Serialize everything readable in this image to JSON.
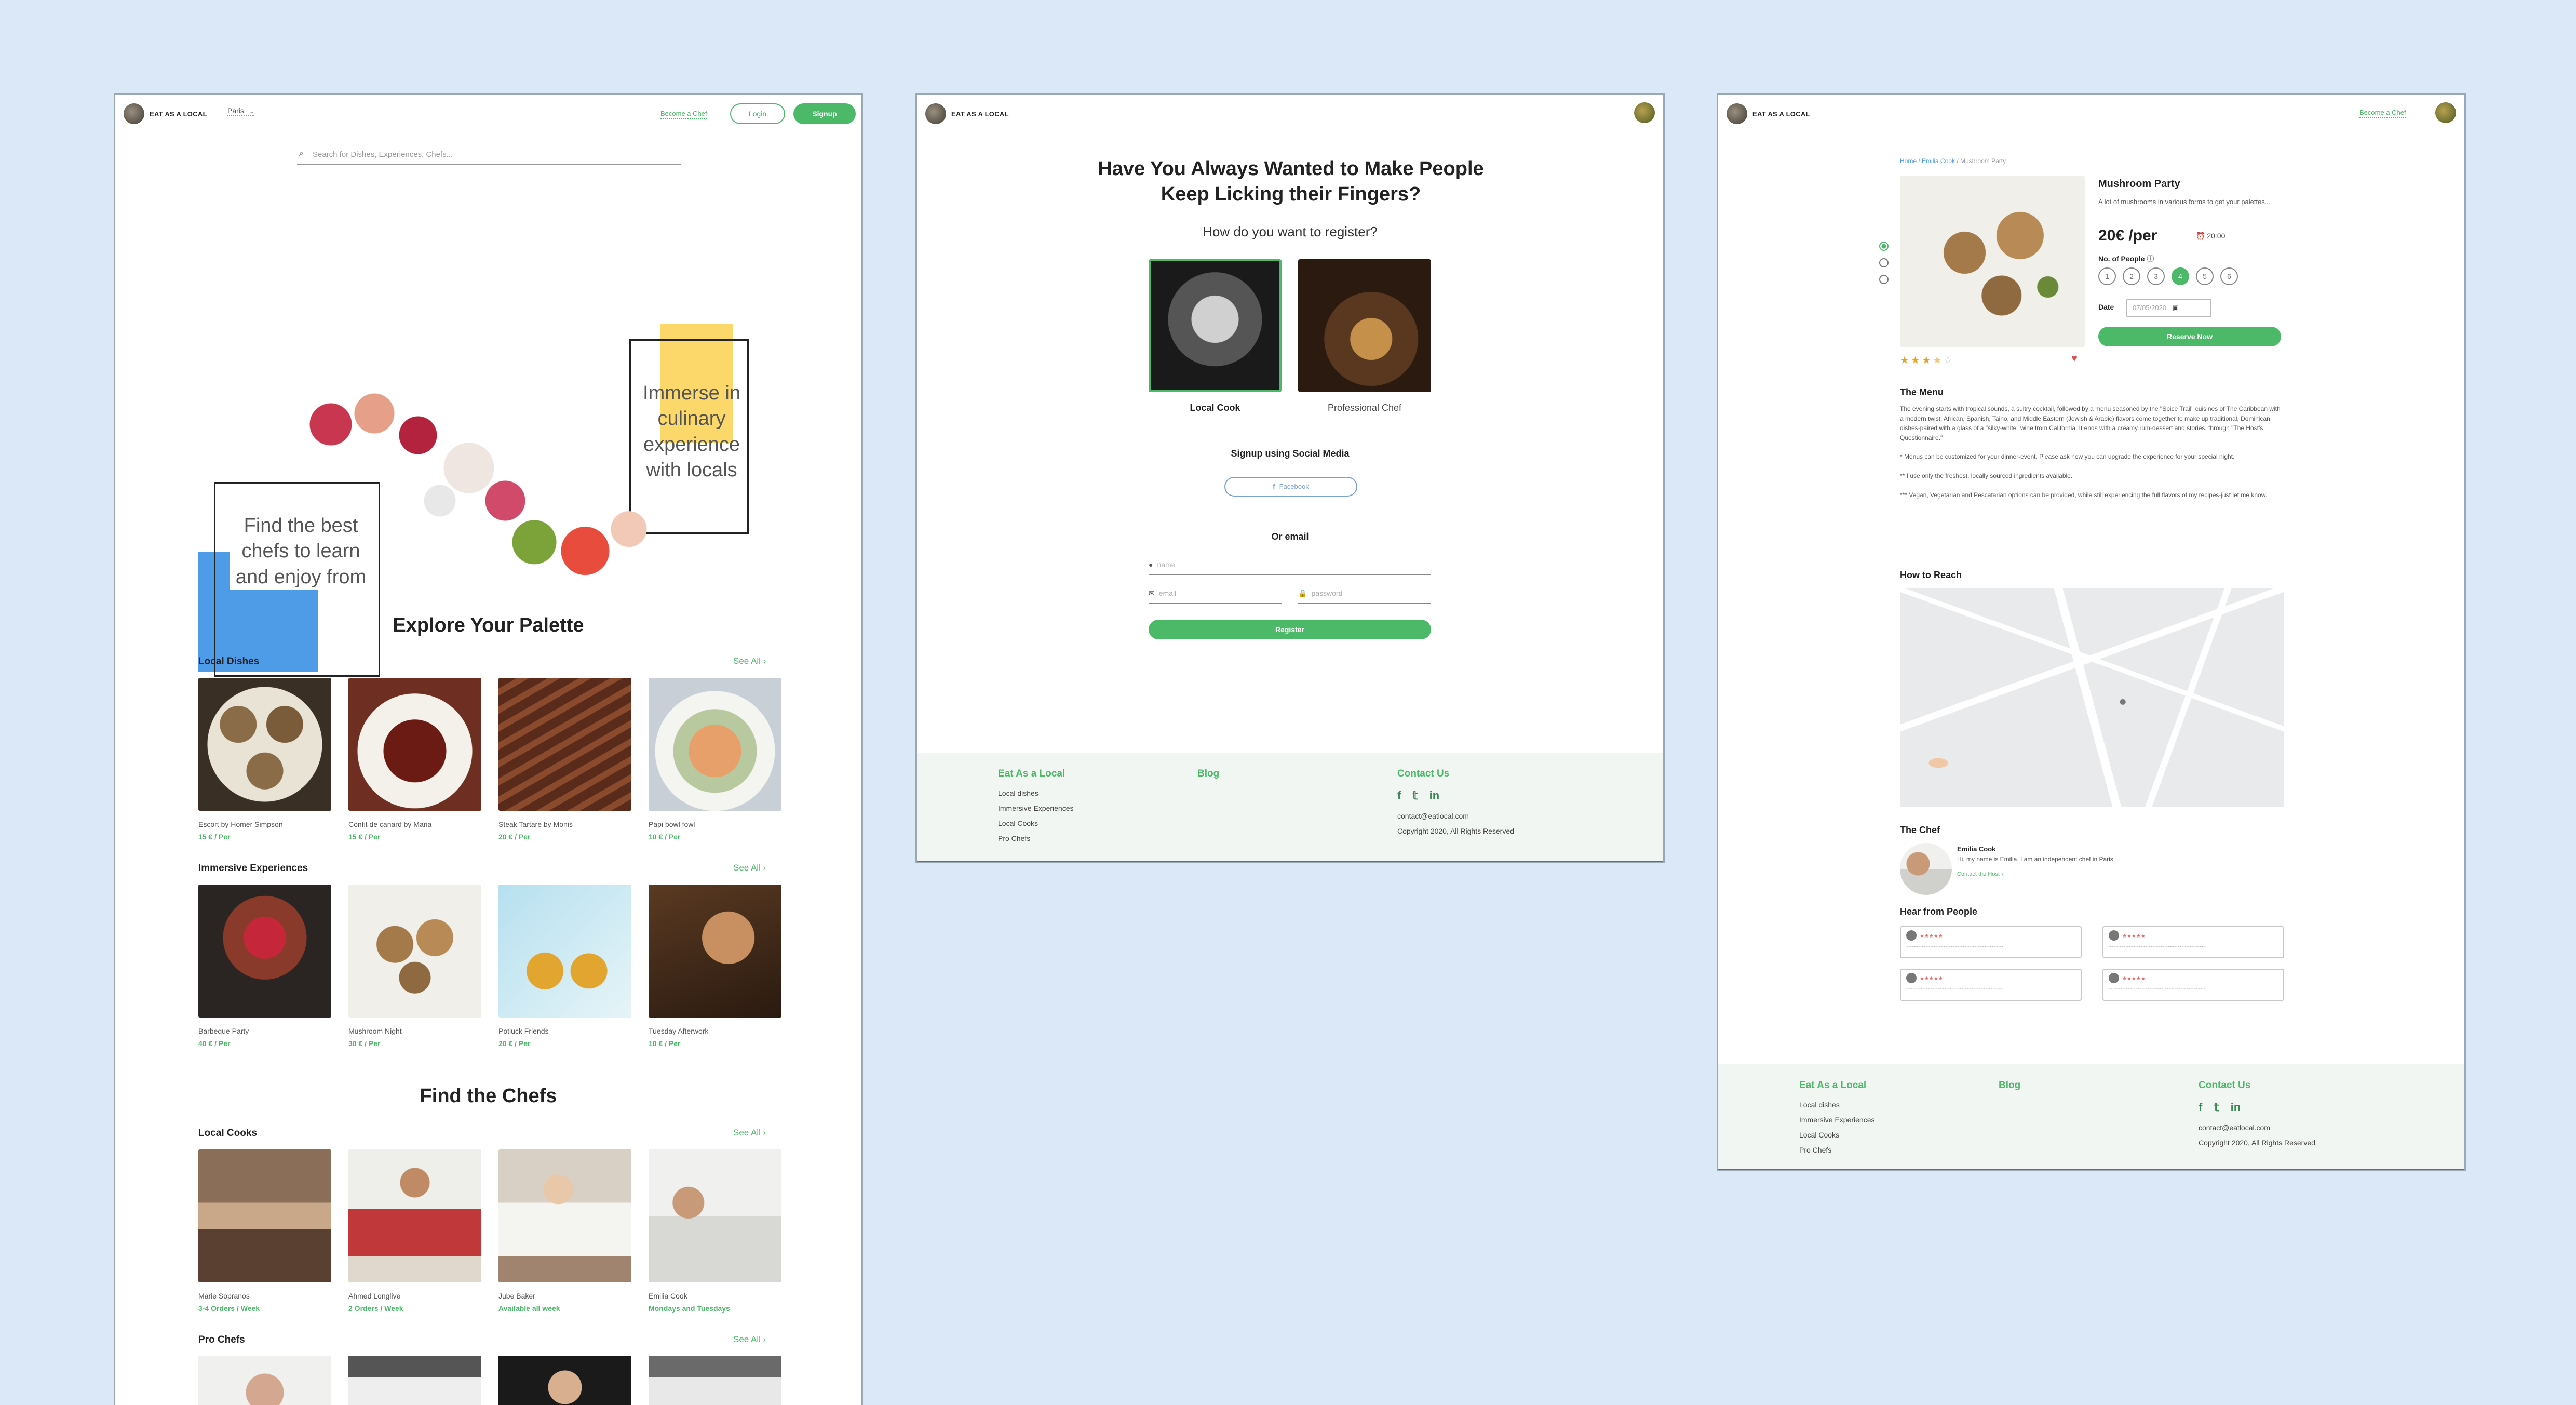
{
  "brand": {
    "name": "EAT AS A LOCAL"
  },
  "home": {
    "city": "Paris",
    "become_chef": "Become a Chef",
    "login": "Login",
    "signup": "Signup",
    "search_placeholder": "Search for Dishes, Experiences, Chefs...",
    "hero": {
      "right_text": "Immerse in culinary experience with locals",
      "left_text": "Find the best chefs to learn and enjoy from"
    },
    "explore_title": "Explore Your Palette",
    "see_all": "See All",
    "local_dishes": {
      "title": "Local Dishes",
      "items": [
        {
          "name": "Escort by Homer Simpson",
          "price": "15 € / Per"
        },
        {
          "name": "Confit de canard by Maria",
          "price": "15 € / Per"
        },
        {
          "name": "Steak Tartare by Monis",
          "price": "20 € / Per"
        },
        {
          "name": "Papi bowl fowl",
          "price": "10 € / Per"
        }
      ]
    },
    "immersive": {
      "title": "Immersive Experiences",
      "items": [
        {
          "name": "Barbeque Party",
          "price": "40 € / Per"
        },
        {
          "name": "Mushroom Night",
          "price": "30 € / Per"
        },
        {
          "name": "Potluck Friends",
          "price": "20 € / Per"
        },
        {
          "name": "Tuesday Afterwork",
          "price": "10 € / Per"
        }
      ]
    },
    "chefs_title": "Find the Chefs",
    "local_cooks": {
      "title": "Local Cooks",
      "items": [
        {
          "name": "Marie Sopranos",
          "price": "3-4 Orders / Week"
        },
        {
          "name": "Ahmed Longlive",
          "price": "2 Orders / Week"
        },
        {
          "name": "Jube Baker",
          "price": "Available all week"
        },
        {
          "name": "Emilia Cook",
          "price": "Mondays and Tuesdays"
        }
      ]
    },
    "pro_chefs": {
      "title": "Pro Chefs"
    }
  },
  "register": {
    "heading": "Have You Always Wanted to Make People Keep Licking their Fingers?",
    "question": "How do you want to register?",
    "option1": "Local Cook",
    "option2": "Professional Chef",
    "social_title": "Signup using Social Media",
    "facebook": "Facebook",
    "or_email": "Or email",
    "name_placeholder": "name",
    "email_placeholder": "email",
    "password_placeholder": "password",
    "register_btn": "Register"
  },
  "footer": {
    "col1_title": "Eat As a Local",
    "col1_items": [
      "Local dishes",
      "Immersive Experiences",
      "Local Cooks",
      "Pro Chefs"
    ],
    "col2_title": "Blog",
    "col3_title": "Contact Us",
    "email": "contact@eatlocal.com",
    "copyright": "Copyright 2020, All Rights Reserved"
  },
  "detail": {
    "breadcrumb": [
      "Home",
      "Emilia Cook",
      "Mushroom Party"
    ],
    "title": "Mushroom Party",
    "desc": "A lot of mushrooms in various forms to get your palettes...",
    "price": "20€ /per",
    "time": "20:00",
    "people_label": "No. of People",
    "people": [
      "1",
      "2",
      "3",
      "4",
      "5",
      "6"
    ],
    "people_selected": "4",
    "date_label": "Date",
    "date_value": "07/05/2020",
    "reserve": "Reserve Now",
    "rating": 3.5,
    "menu_title": "The Menu",
    "menu_p1": "The evening starts with tropical sounds, a sultry cocktail, followed by a menu seasoned by the \"Spice Trail\" cuisines of The Caribbean with a modern twist. African, Spanish, Taino, and Middle Eastern (Jewish & Arabic) flavors come together to make up traditional, Dominican, dishes-paired with a glass of a \"silky-white\" wine from California. It ends with a creamy rum-dessert and stories, through \"The Host's Questionnaire.\"",
    "menu_p2": "* Menus can be customized for your dinner-event. Please ask how you can upgrade the experience for your special night.",
    "menu_p3": "** I use only the freshest, locally sourced ingredients available.",
    "menu_p4": "*** Vegan, Vegetarian and Pescatarian options can be provided, while still experiencing the full flavors of my recipes-just let me know.",
    "reach_title": "How to Reach",
    "chef_title": "The Chef",
    "chef_name": "Emilia Cook",
    "chef_bio": "Hi, my name is Emilia. I am an independent chef in Paris.",
    "chef_contact": "Contact the Host",
    "hear_title": "Hear from People"
  },
  "colors": {
    "accent": "#4cb969",
    "background": "#dae8f8",
    "footer": "#f2f6f3",
    "blue_block": "#4e9be8",
    "yellow_block": "#fcd86a"
  }
}
